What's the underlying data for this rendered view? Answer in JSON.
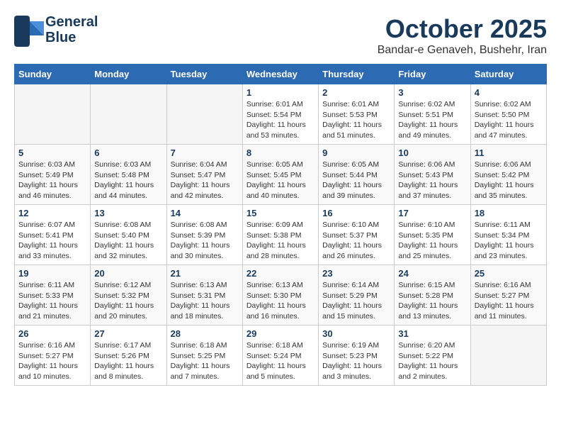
{
  "header": {
    "logo_line1": "General",
    "logo_line2": "Blue",
    "month": "October 2025",
    "location": "Bandar-e Genaveh, Bushehr, Iran"
  },
  "weekdays": [
    "Sunday",
    "Monday",
    "Tuesday",
    "Wednesday",
    "Thursday",
    "Friday",
    "Saturday"
  ],
  "weeks": [
    [
      {
        "day": "",
        "empty": true
      },
      {
        "day": "",
        "empty": true
      },
      {
        "day": "",
        "empty": true
      },
      {
        "day": "1",
        "sunrise": "6:01 AM",
        "sunset": "5:54 PM",
        "daylight": "11 hours and 53 minutes."
      },
      {
        "day": "2",
        "sunrise": "6:01 AM",
        "sunset": "5:53 PM",
        "daylight": "11 hours and 51 minutes."
      },
      {
        "day": "3",
        "sunrise": "6:02 AM",
        "sunset": "5:51 PM",
        "daylight": "11 hours and 49 minutes."
      },
      {
        "day": "4",
        "sunrise": "6:02 AM",
        "sunset": "5:50 PM",
        "daylight": "11 hours and 47 minutes."
      }
    ],
    [
      {
        "day": "5",
        "sunrise": "6:03 AM",
        "sunset": "5:49 PM",
        "daylight": "11 hours and 46 minutes."
      },
      {
        "day": "6",
        "sunrise": "6:03 AM",
        "sunset": "5:48 PM",
        "daylight": "11 hours and 44 minutes."
      },
      {
        "day": "7",
        "sunrise": "6:04 AM",
        "sunset": "5:47 PM",
        "daylight": "11 hours and 42 minutes."
      },
      {
        "day": "8",
        "sunrise": "6:05 AM",
        "sunset": "5:45 PM",
        "daylight": "11 hours and 40 minutes."
      },
      {
        "day": "9",
        "sunrise": "6:05 AM",
        "sunset": "5:44 PM",
        "daylight": "11 hours and 39 minutes."
      },
      {
        "day": "10",
        "sunrise": "6:06 AM",
        "sunset": "5:43 PM",
        "daylight": "11 hours and 37 minutes."
      },
      {
        "day": "11",
        "sunrise": "6:06 AM",
        "sunset": "5:42 PM",
        "daylight": "11 hours and 35 minutes."
      }
    ],
    [
      {
        "day": "12",
        "sunrise": "6:07 AM",
        "sunset": "5:41 PM",
        "daylight": "11 hours and 33 minutes."
      },
      {
        "day": "13",
        "sunrise": "6:08 AM",
        "sunset": "5:40 PM",
        "daylight": "11 hours and 32 minutes."
      },
      {
        "day": "14",
        "sunrise": "6:08 AM",
        "sunset": "5:39 PM",
        "daylight": "11 hours and 30 minutes."
      },
      {
        "day": "15",
        "sunrise": "6:09 AM",
        "sunset": "5:38 PM",
        "daylight": "11 hours and 28 minutes."
      },
      {
        "day": "16",
        "sunrise": "6:10 AM",
        "sunset": "5:37 PM",
        "daylight": "11 hours and 26 minutes."
      },
      {
        "day": "17",
        "sunrise": "6:10 AM",
        "sunset": "5:35 PM",
        "daylight": "11 hours and 25 minutes."
      },
      {
        "day": "18",
        "sunrise": "6:11 AM",
        "sunset": "5:34 PM",
        "daylight": "11 hours and 23 minutes."
      }
    ],
    [
      {
        "day": "19",
        "sunrise": "6:11 AM",
        "sunset": "5:33 PM",
        "daylight": "11 hours and 21 minutes."
      },
      {
        "day": "20",
        "sunrise": "6:12 AM",
        "sunset": "5:32 PM",
        "daylight": "11 hours and 20 minutes."
      },
      {
        "day": "21",
        "sunrise": "6:13 AM",
        "sunset": "5:31 PM",
        "daylight": "11 hours and 18 minutes."
      },
      {
        "day": "22",
        "sunrise": "6:13 AM",
        "sunset": "5:30 PM",
        "daylight": "11 hours and 16 minutes."
      },
      {
        "day": "23",
        "sunrise": "6:14 AM",
        "sunset": "5:29 PM",
        "daylight": "11 hours and 15 minutes."
      },
      {
        "day": "24",
        "sunrise": "6:15 AM",
        "sunset": "5:28 PM",
        "daylight": "11 hours and 13 minutes."
      },
      {
        "day": "25",
        "sunrise": "6:16 AM",
        "sunset": "5:27 PM",
        "daylight": "11 hours and 11 minutes."
      }
    ],
    [
      {
        "day": "26",
        "sunrise": "6:16 AM",
        "sunset": "5:27 PM",
        "daylight": "11 hours and 10 minutes."
      },
      {
        "day": "27",
        "sunrise": "6:17 AM",
        "sunset": "5:26 PM",
        "daylight": "11 hours and 8 minutes."
      },
      {
        "day": "28",
        "sunrise": "6:18 AM",
        "sunset": "5:25 PM",
        "daylight": "11 hours and 7 minutes."
      },
      {
        "day": "29",
        "sunrise": "6:18 AM",
        "sunset": "5:24 PM",
        "daylight": "11 hours and 5 minutes."
      },
      {
        "day": "30",
        "sunrise": "6:19 AM",
        "sunset": "5:23 PM",
        "daylight": "11 hours and 3 minutes."
      },
      {
        "day": "31",
        "sunrise": "6:20 AM",
        "sunset": "5:22 PM",
        "daylight": "11 hours and 2 minutes."
      },
      {
        "day": "",
        "empty": true
      }
    ]
  ]
}
